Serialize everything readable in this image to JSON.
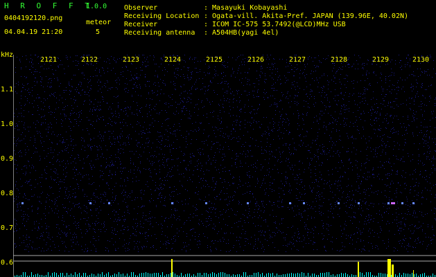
{
  "header": {
    "app_name": "H R O F F T",
    "version": "1.0.0",
    "filename": "0404192120.png",
    "datetime": "04.04.19 21:20",
    "meteor_label": "meteor",
    "meteor_count": "5"
  },
  "station": [
    {
      "key": "Observer",
      "value": ": Masayuki Kobayashi"
    },
    {
      "key": "Receiving Location",
      "value": ": Ogata-vill. Akita-Pref. JAPAN (139.96E, 40.02N)"
    },
    {
      "key": "Receiver",
      "value": ": ICOM IC-575 53.7492(@LCD)MHz USB"
    },
    {
      "key": "Receiving antenna",
      "value": ": A504HB(yagi 4el)"
    }
  ],
  "spectrogram": {
    "unit_label": "kHz",
    "time_ticks": [
      "2121",
      "2122",
      "2123",
      "2124",
      "2125",
      "2126",
      "2127",
      "2128",
      "2129",
      "2130"
    ],
    "freq_ticks": [
      "1.1",
      "1.0",
      "0.9",
      "0.8",
      "0.7",
      "0.6"
    ],
    "colors": {
      "background": "#000000",
      "noise": "#1a1a88",
      "axis": "#ffffff",
      "text": "#ffff00",
      "level_bar": "#ffff00",
      "level_line": "#00ffff"
    }
  }
}
